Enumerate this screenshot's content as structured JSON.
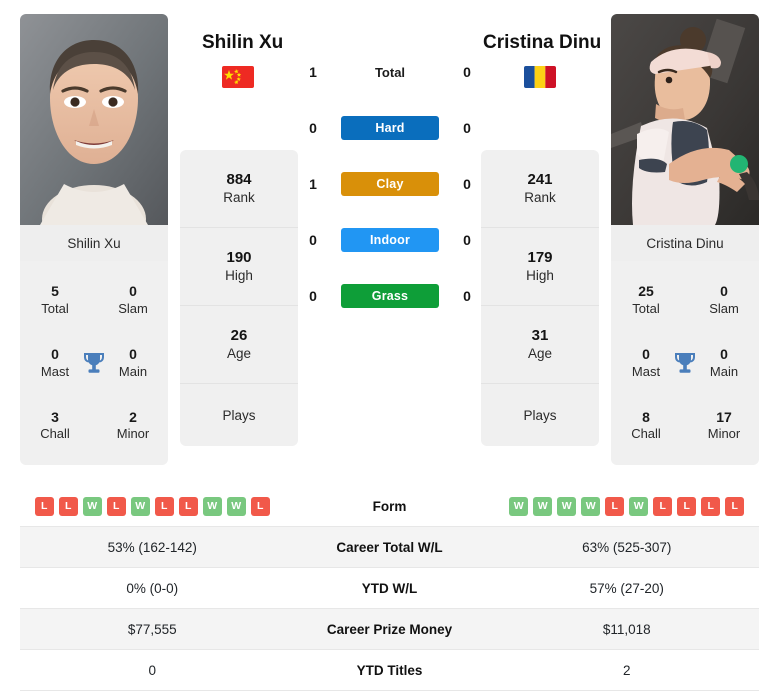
{
  "players": {
    "left": {
      "name": "Shilin Xu",
      "photo_caption": "Shilin Xu",
      "flag": "cn",
      "rank": "884",
      "rank_label": "Rank",
      "high": "190",
      "high_label": "High",
      "age": "26",
      "age_label": "Age",
      "plays_label": "Plays",
      "titles": {
        "total": "5",
        "total_label": "Total",
        "slam": "0",
        "slam_label": "Slam",
        "mast": "0",
        "mast_label": "Mast",
        "main": "0",
        "main_label": "Main",
        "chall": "3",
        "chall_label": "Chall",
        "minor": "2",
        "minor_label": "Minor"
      },
      "form": [
        "L",
        "L",
        "W",
        "L",
        "W",
        "L",
        "L",
        "W",
        "W",
        "L"
      ],
      "career_wl": "53% (162-142)",
      "ytd_wl": "0% (0-0)",
      "prize_money": "$77,555",
      "ytd_titles": "0"
    },
    "right": {
      "name": "Cristina Dinu",
      "photo_caption": "Cristina Dinu",
      "flag": "ro",
      "rank": "241",
      "rank_label": "Rank",
      "high": "179",
      "high_label": "High",
      "age": "31",
      "age_label": "Age",
      "plays_label": "Plays",
      "titles": {
        "total": "25",
        "total_label": "Total",
        "slam": "0",
        "slam_label": "Slam",
        "mast": "0",
        "mast_label": "Mast",
        "main": "0",
        "main_label": "Main",
        "chall": "8",
        "chall_label": "Chall",
        "minor": "17",
        "minor_label": "Minor"
      },
      "form": [
        "W",
        "W",
        "W",
        "W",
        "L",
        "W",
        "L",
        "L",
        "L",
        "L"
      ],
      "career_wl": "63% (525-307)",
      "ytd_wl": "57% (27-20)",
      "prize_money": "$11,018",
      "ytd_titles": "2"
    }
  },
  "head_to_head": {
    "total": {
      "label": "Total",
      "left": "1",
      "right": "0"
    },
    "surfaces": [
      {
        "label": "Hard",
        "left": "0",
        "right": "0",
        "color": "#0a6ebd"
      },
      {
        "label": "Clay",
        "left": "1",
        "right": "0",
        "color": "#d99009"
      },
      {
        "label": "Indoor",
        "left": "0",
        "right": "0",
        "color": "#2196f3"
      },
      {
        "label": "Grass",
        "left": "0",
        "right": "0",
        "color": "#0e9e38"
      }
    ]
  },
  "stat_rows": {
    "form_label": "Form",
    "career_label": "Career Total W/L",
    "ytd_label": "YTD W/L",
    "prize_label": "Career Prize Money",
    "ytd_titles_label": "YTD Titles"
  },
  "colors": {
    "win": "#79c87f",
    "loss": "#f1594a",
    "panel": "#f0f0f0",
    "row_shade": "#f4f4f4"
  }
}
